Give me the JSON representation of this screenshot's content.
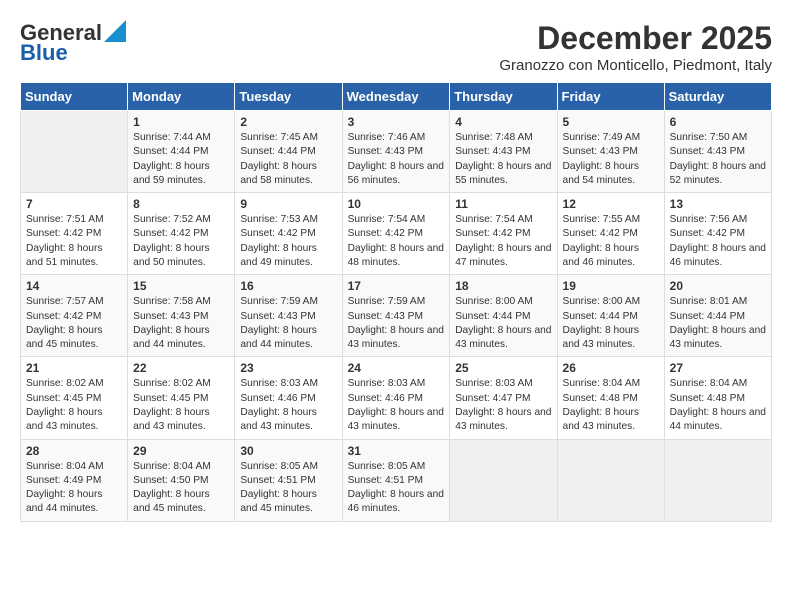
{
  "logo": {
    "line1": "General",
    "line2": "Blue"
  },
  "title": "December 2025",
  "subtitle": "Granozzo con Monticello, Piedmont, Italy",
  "days_of_week": [
    "Sunday",
    "Monday",
    "Tuesday",
    "Wednesday",
    "Thursday",
    "Friday",
    "Saturday"
  ],
  "weeks": [
    [
      {
        "day": "",
        "sunrise": "",
        "sunset": "",
        "daylight": "",
        "empty": true
      },
      {
        "day": "1",
        "sunrise": "Sunrise: 7:44 AM",
        "sunset": "Sunset: 4:44 PM",
        "daylight": "Daylight: 8 hours and 59 minutes."
      },
      {
        "day": "2",
        "sunrise": "Sunrise: 7:45 AM",
        "sunset": "Sunset: 4:44 PM",
        "daylight": "Daylight: 8 hours and 58 minutes."
      },
      {
        "day": "3",
        "sunrise": "Sunrise: 7:46 AM",
        "sunset": "Sunset: 4:43 PM",
        "daylight": "Daylight: 8 hours and 56 minutes."
      },
      {
        "day": "4",
        "sunrise": "Sunrise: 7:48 AM",
        "sunset": "Sunset: 4:43 PM",
        "daylight": "Daylight: 8 hours and 55 minutes."
      },
      {
        "day": "5",
        "sunrise": "Sunrise: 7:49 AM",
        "sunset": "Sunset: 4:43 PM",
        "daylight": "Daylight: 8 hours and 54 minutes."
      },
      {
        "day": "6",
        "sunrise": "Sunrise: 7:50 AM",
        "sunset": "Sunset: 4:43 PM",
        "daylight": "Daylight: 8 hours and 52 minutes."
      }
    ],
    [
      {
        "day": "7",
        "sunrise": "Sunrise: 7:51 AM",
        "sunset": "Sunset: 4:42 PM",
        "daylight": "Daylight: 8 hours and 51 minutes."
      },
      {
        "day": "8",
        "sunrise": "Sunrise: 7:52 AM",
        "sunset": "Sunset: 4:42 PM",
        "daylight": "Daylight: 8 hours and 50 minutes."
      },
      {
        "day": "9",
        "sunrise": "Sunrise: 7:53 AM",
        "sunset": "Sunset: 4:42 PM",
        "daylight": "Daylight: 8 hours and 49 minutes."
      },
      {
        "day": "10",
        "sunrise": "Sunrise: 7:54 AM",
        "sunset": "Sunset: 4:42 PM",
        "daylight": "Daylight: 8 hours and 48 minutes."
      },
      {
        "day": "11",
        "sunrise": "Sunrise: 7:54 AM",
        "sunset": "Sunset: 4:42 PM",
        "daylight": "Daylight: 8 hours and 47 minutes."
      },
      {
        "day": "12",
        "sunrise": "Sunrise: 7:55 AM",
        "sunset": "Sunset: 4:42 PM",
        "daylight": "Daylight: 8 hours and 46 minutes."
      },
      {
        "day": "13",
        "sunrise": "Sunrise: 7:56 AM",
        "sunset": "Sunset: 4:42 PM",
        "daylight": "Daylight: 8 hours and 46 minutes."
      }
    ],
    [
      {
        "day": "14",
        "sunrise": "Sunrise: 7:57 AM",
        "sunset": "Sunset: 4:42 PM",
        "daylight": "Daylight: 8 hours and 45 minutes."
      },
      {
        "day": "15",
        "sunrise": "Sunrise: 7:58 AM",
        "sunset": "Sunset: 4:43 PM",
        "daylight": "Daylight: 8 hours and 44 minutes."
      },
      {
        "day": "16",
        "sunrise": "Sunrise: 7:59 AM",
        "sunset": "Sunset: 4:43 PM",
        "daylight": "Daylight: 8 hours and 44 minutes."
      },
      {
        "day": "17",
        "sunrise": "Sunrise: 7:59 AM",
        "sunset": "Sunset: 4:43 PM",
        "daylight": "Daylight: 8 hours and 43 minutes."
      },
      {
        "day": "18",
        "sunrise": "Sunrise: 8:00 AM",
        "sunset": "Sunset: 4:44 PM",
        "daylight": "Daylight: 8 hours and 43 minutes."
      },
      {
        "day": "19",
        "sunrise": "Sunrise: 8:00 AM",
        "sunset": "Sunset: 4:44 PM",
        "daylight": "Daylight: 8 hours and 43 minutes."
      },
      {
        "day": "20",
        "sunrise": "Sunrise: 8:01 AM",
        "sunset": "Sunset: 4:44 PM",
        "daylight": "Daylight: 8 hours and 43 minutes."
      }
    ],
    [
      {
        "day": "21",
        "sunrise": "Sunrise: 8:02 AM",
        "sunset": "Sunset: 4:45 PM",
        "daylight": "Daylight: 8 hours and 43 minutes."
      },
      {
        "day": "22",
        "sunrise": "Sunrise: 8:02 AM",
        "sunset": "Sunset: 4:45 PM",
        "daylight": "Daylight: 8 hours and 43 minutes."
      },
      {
        "day": "23",
        "sunrise": "Sunrise: 8:03 AM",
        "sunset": "Sunset: 4:46 PM",
        "daylight": "Daylight: 8 hours and 43 minutes."
      },
      {
        "day": "24",
        "sunrise": "Sunrise: 8:03 AM",
        "sunset": "Sunset: 4:46 PM",
        "daylight": "Daylight: 8 hours and 43 minutes."
      },
      {
        "day": "25",
        "sunrise": "Sunrise: 8:03 AM",
        "sunset": "Sunset: 4:47 PM",
        "daylight": "Daylight: 8 hours and 43 minutes."
      },
      {
        "day": "26",
        "sunrise": "Sunrise: 8:04 AM",
        "sunset": "Sunset: 4:48 PM",
        "daylight": "Daylight: 8 hours and 43 minutes."
      },
      {
        "day": "27",
        "sunrise": "Sunrise: 8:04 AM",
        "sunset": "Sunset: 4:48 PM",
        "daylight": "Daylight: 8 hours and 44 minutes."
      }
    ],
    [
      {
        "day": "28",
        "sunrise": "Sunrise: 8:04 AM",
        "sunset": "Sunset: 4:49 PM",
        "daylight": "Daylight: 8 hours and 44 minutes."
      },
      {
        "day": "29",
        "sunrise": "Sunrise: 8:04 AM",
        "sunset": "Sunset: 4:50 PM",
        "daylight": "Daylight: 8 hours and 45 minutes."
      },
      {
        "day": "30",
        "sunrise": "Sunrise: 8:05 AM",
        "sunset": "Sunset: 4:51 PM",
        "daylight": "Daylight: 8 hours and 45 minutes."
      },
      {
        "day": "31",
        "sunrise": "Sunrise: 8:05 AM",
        "sunset": "Sunset: 4:51 PM",
        "daylight": "Daylight: 8 hours and 46 minutes."
      },
      {
        "day": "",
        "sunrise": "",
        "sunset": "",
        "daylight": "",
        "empty": true
      },
      {
        "day": "",
        "sunrise": "",
        "sunset": "",
        "daylight": "",
        "empty": true
      },
      {
        "day": "",
        "sunrise": "",
        "sunset": "",
        "daylight": "",
        "empty": true
      }
    ]
  ]
}
